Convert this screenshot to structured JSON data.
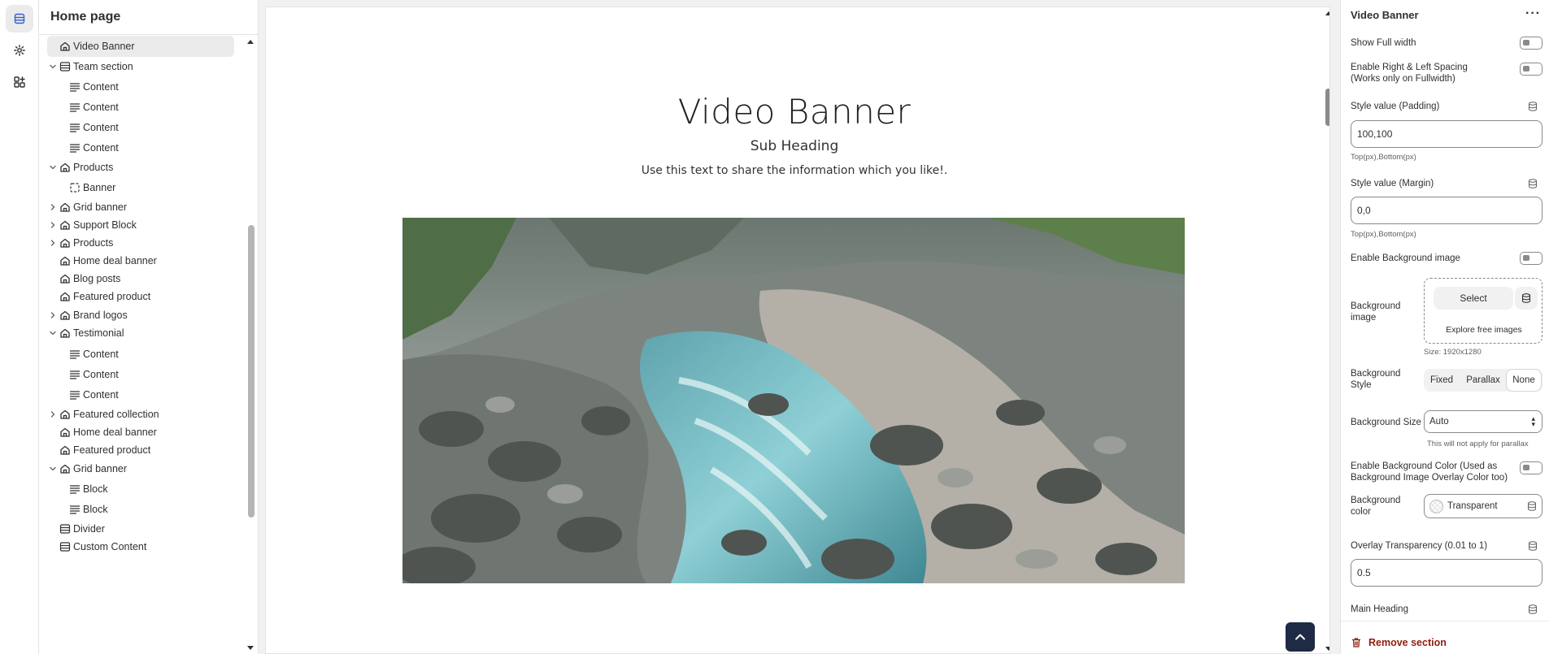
{
  "sidebar": {
    "title": "Home page",
    "items": [
      {
        "label": "Video Banner",
        "icon": "home-icon",
        "level": 0,
        "chevron": "none",
        "selected": true
      },
      {
        "label": "Team section",
        "icon": "table-icon",
        "level": 0,
        "chevron": "down"
      },
      {
        "label": "Content",
        "icon": "text-lines-icon",
        "level": 1,
        "chevron": "none"
      },
      {
        "label": "Content",
        "icon": "text-lines-icon",
        "level": 1,
        "chevron": "none"
      },
      {
        "label": "Content",
        "icon": "text-lines-icon",
        "level": 1,
        "chevron": "none"
      },
      {
        "label": "Content",
        "icon": "text-lines-icon",
        "level": 1,
        "chevron": "none"
      },
      {
        "label": "Products",
        "icon": "home-icon",
        "level": 0,
        "chevron": "down"
      },
      {
        "label": "Banner",
        "icon": "image-frame-icon",
        "level": 1,
        "chevron": "none"
      },
      {
        "label": "Grid banner",
        "icon": "home-icon",
        "level": 0,
        "chevron": "right"
      },
      {
        "label": "Support Block",
        "icon": "home-icon",
        "level": 0,
        "chevron": "right"
      },
      {
        "label": "Products",
        "icon": "home-icon",
        "level": 0,
        "chevron": "right"
      },
      {
        "label": "Home deal banner",
        "icon": "home-icon",
        "level": 0,
        "chevron": "none"
      },
      {
        "label": "Blog posts",
        "icon": "home-icon",
        "level": 0,
        "chevron": "none"
      },
      {
        "label": "Featured product",
        "icon": "home-icon",
        "level": 0,
        "chevron": "none"
      },
      {
        "label": "Brand logos",
        "icon": "home-icon",
        "level": 0,
        "chevron": "right"
      },
      {
        "label": "Testimonial",
        "icon": "home-icon",
        "level": 0,
        "chevron": "down"
      },
      {
        "label": "Content",
        "icon": "text-lines-icon",
        "level": 1,
        "chevron": "none"
      },
      {
        "label": "Content",
        "icon": "text-lines-icon",
        "level": 1,
        "chevron": "none"
      },
      {
        "label": "Content",
        "icon": "text-lines-icon",
        "level": 1,
        "chevron": "none"
      },
      {
        "label": "Featured collection",
        "icon": "home-icon",
        "level": 0,
        "chevron": "right"
      },
      {
        "label": "Home deal banner",
        "icon": "home-icon",
        "level": 0,
        "chevron": "none"
      },
      {
        "label": "Featured product",
        "icon": "home-icon",
        "level": 0,
        "chevron": "none"
      },
      {
        "label": "Grid banner",
        "icon": "home-icon",
        "level": 0,
        "chevron": "down"
      },
      {
        "label": "Block",
        "icon": "text-lines-icon",
        "level": 1,
        "chevron": "none"
      },
      {
        "label": "Block",
        "icon": "text-lines-icon",
        "level": 1,
        "chevron": "none"
      },
      {
        "label": "Divider",
        "icon": "table-icon",
        "level": 0,
        "chevron": "none"
      },
      {
        "label": "Custom Content",
        "icon": "table-icon",
        "level": 0,
        "chevron": "none"
      }
    ]
  },
  "preview": {
    "heading": "Video Banner",
    "subheading": "Sub Heading",
    "text": "Use this text to share the information which you like!."
  },
  "panel": {
    "title": "Video Banner",
    "more": "···",
    "show_full_width": "Show Full width",
    "enable_spacing": "Enable Right & Left Spacing (Works only on Fullwidth)",
    "padding_label": "Style value (Padding)",
    "padding_value": "100,100",
    "padding_help": "Top(px),Bottom(px)",
    "margin_label": "Style value (Margin)",
    "margin_value": "0,0",
    "margin_help": "Top(px),Bottom(px)",
    "enable_bg_image": "Enable Background image",
    "bg_image_label": "Background image",
    "bg_select": "Select",
    "bg_explore": "Explore free images",
    "bg_size_hint": "Size: 1920x1280",
    "bg_style_label": "Background Style",
    "bg_style_options": [
      "Fixed",
      "Parallax",
      "None"
    ],
    "bg_style_selected": "None",
    "bg_size_label": "Background Size",
    "bg_size_value": "Auto",
    "bg_size_help": "This will not apply for parallax",
    "enable_bg_color": "Enable Background Color (Used as Background Image Overlay Color too)",
    "bg_color_label": "Background color",
    "bg_color_value": "Transparent",
    "overlay_label": "Overlay Transparency (0.01 to 1)",
    "overlay_value": "0.5",
    "main_heading_label": "Main Heading",
    "remove_section": "Remove section"
  },
  "colors": {
    "accent_dark": "#1f2a44",
    "danger": "#8e1f0b",
    "selected_bg": "#ebebeb"
  }
}
